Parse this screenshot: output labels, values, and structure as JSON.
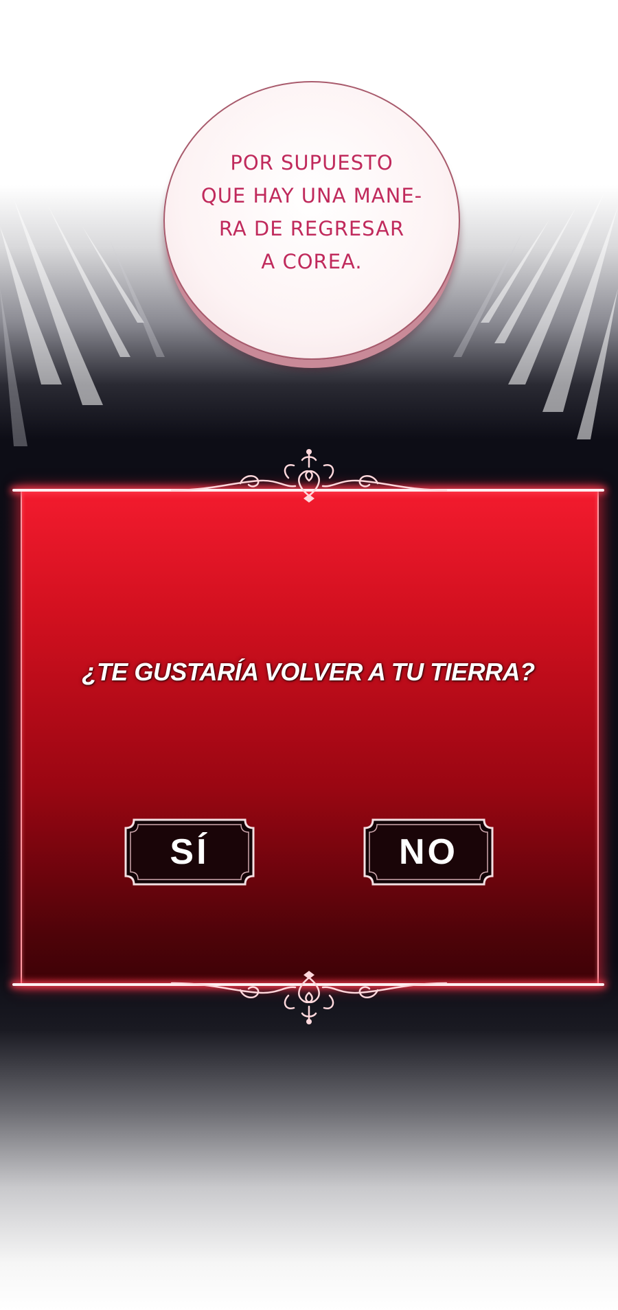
{
  "speech_bubble": {
    "lines": [
      "POR SUPUESTO",
      "QUE HAY UNA MANE-",
      "RA DE REGRESAR",
      "A COREA."
    ]
  },
  "dialog": {
    "question": "¿TE GUSTARÍA VOLVER A TU TIERRA?",
    "yes_label": "SÍ",
    "no_label": "NO"
  },
  "colors": {
    "panel_red": "#d2101f",
    "bubble_text": "#c02a5c",
    "glow": "#ff2840"
  }
}
